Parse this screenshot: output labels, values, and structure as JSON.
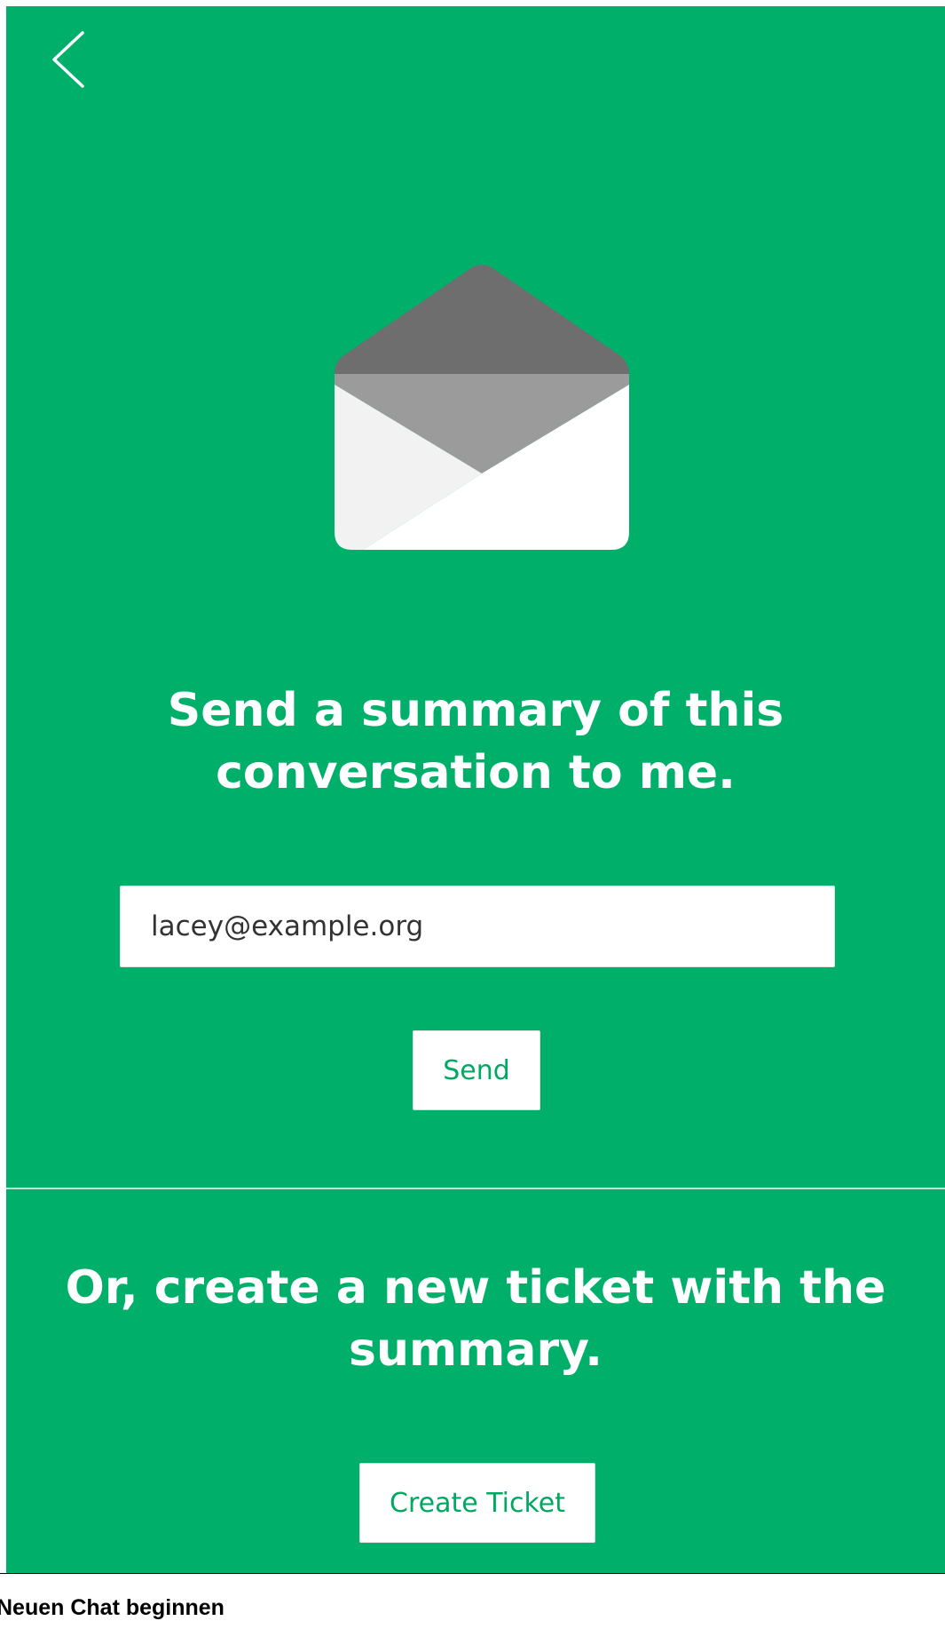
{
  "panel": {
    "accent_color": "#00b06a",
    "back_icon": "chevron-left-icon",
    "envelope_icon": "open-envelope-icon"
  },
  "email_summary": {
    "heading_line1": "Send a summary of this",
    "heading_line2": "conversation to me.",
    "email_value": "lacey@example.org",
    "send_label": "Send"
  },
  "ticket": {
    "heading_line1": "Or, create a new ticket with the",
    "heading_line2": "summary.",
    "create_label": "Create Ticket"
  },
  "footer": {
    "new_chat_label": "Neuen Chat beginnen"
  }
}
